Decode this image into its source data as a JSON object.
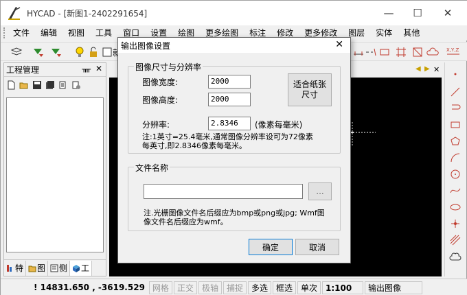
{
  "window": {
    "title": "HYCAD - [新图1-2402291654]",
    "min_glyph": "—",
    "max_glyph": "☐",
    "close_glyph": "✕"
  },
  "menu": [
    "文件",
    "编辑",
    "视图",
    "工具",
    "窗口",
    "设置",
    "绘图",
    "更多绘图",
    "标注",
    "修改",
    "更多修改",
    "图层",
    "实体",
    "其他"
  ],
  "left_panel": {
    "title": "工程管理",
    "pin_glyph": "ᚄ",
    "close_glyph": "✕",
    "tabs": [
      {
        "icon": "property-icon",
        "label": "特"
      },
      {
        "icon": "folder-icon",
        "label": "图"
      },
      {
        "icon": "layer-icon",
        "label": "侧"
      },
      {
        "icon": "block-icon",
        "label": "工"
      }
    ]
  },
  "toolbar_text": {
    "partial": "就"
  },
  "status": {
    "coords": "14831.650 , -3619.529",
    "items": [
      {
        "label": "网格",
        "state": "off"
      },
      {
        "label": "正交",
        "state": "off"
      },
      {
        "label": "极轴",
        "state": "off"
      },
      {
        "label": "捕捉",
        "state": "off"
      },
      {
        "label": "多选",
        "state": "on"
      },
      {
        "label": "框选",
        "state": "on"
      },
      {
        "label": "单次",
        "state": "on"
      }
    ],
    "scale": "1:100",
    "command": "输出图像"
  },
  "dialog": {
    "title": "输出图像设置",
    "close_glyph": "✕",
    "size_group": {
      "label": "图像尺寸与分辨率",
      "width_label": "图像宽度:",
      "width_value": "2000",
      "height_label": "图像高度:",
      "height_value": "2000",
      "fit_button": "适合纸张\n尺寸",
      "resolution_label": "分辨率:",
      "resolution_value": "2.8346",
      "resolution_unit": "(像素每毫米)",
      "note_line1": "注:1英寸=25.4毫米,通常图像分辨率设可为72像素",
      "note_line2": "每英寸,即2.8346像素每毫米。"
    },
    "file_group": {
      "label": "文件名称",
      "filename_value": "",
      "browse_button": "...",
      "note_line1": "注.光栅图像文件名后缀应为bmp或png或jpg; Wmf图",
      "note_line2": "像文件名后缀应为wmf。"
    },
    "ok_button": "确定",
    "cancel_button": "取消"
  },
  "colors": {
    "canvas": "#000000",
    "accent_red": "#c0392b",
    "accent_green": "#2e8b2e"
  }
}
